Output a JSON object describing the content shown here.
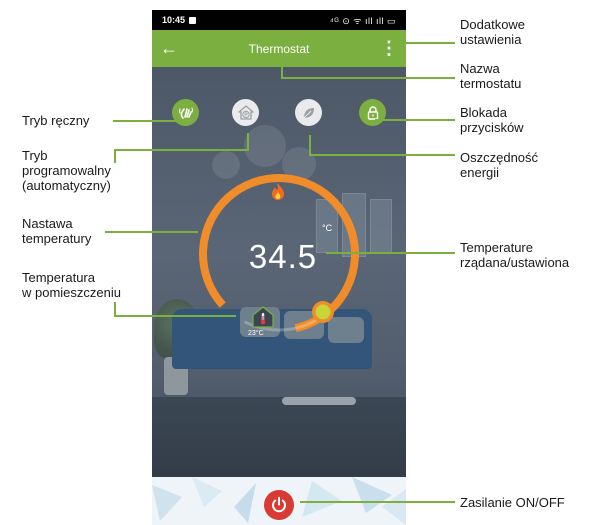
{
  "status_bar": {
    "time": "10:45",
    "icons": "⁴ᴳ ⊙ ᯤ ıll ıll ▭"
  },
  "app_bar": {
    "title": "Thermostat",
    "back_icon": "arrow-left-icon",
    "menu_icon": "more-vertical-icon"
  },
  "controls": {
    "manual_mode_icon": "hand-wave-icon",
    "program_mode_icon": "home-p-icon",
    "eco_icon": "leaf-icon",
    "lock_icon": "lock-icon"
  },
  "dial": {
    "set_temperature": "34.5",
    "unit": "°C",
    "room_temperature": "23°C",
    "heating_icon": "flame-icon",
    "accent_color": "#f08c2a",
    "knob_color": "#c7d53a"
  },
  "power": {
    "icon": "power-icon",
    "color": "#d83a34"
  },
  "labels": {
    "extra_settings": [
      "Dodatkowe",
      "ustawienia"
    ],
    "thermostat_name": [
      "Nazwa",
      "termostatu"
    ],
    "button_lock": [
      "Blokada",
      "przycisków"
    ],
    "energy_saving": [
      "Oszczędność",
      "energii"
    ],
    "target_temperature": [
      "Temperature",
      "rządana/ustawiona"
    ],
    "power_toggle": [
      "Zasilanie ON/OFF"
    ],
    "manual_mode": [
      "Tryb ręczny"
    ],
    "programmable_mode": [
      "Tryb",
      "programowalny",
      "(automatyczny)"
    ],
    "temperature_setpoint": [
      "Nastawa",
      "temperatury"
    ],
    "room_temperature": [
      "Temperatura",
      "w pomieszczeniu"
    ]
  },
  "colors": {
    "brand_green": "#7bb041",
    "leader_green": "#7bb041"
  }
}
